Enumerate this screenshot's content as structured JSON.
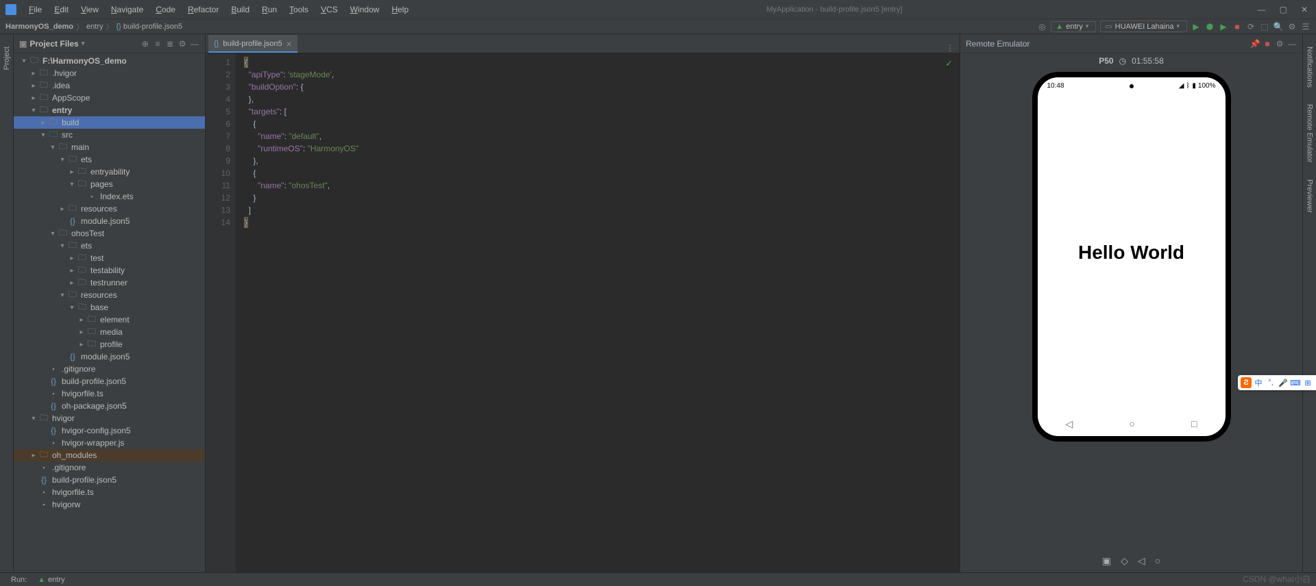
{
  "title": "MyApplication - build-profile.json5 [entry]",
  "menu": [
    "File",
    "Edit",
    "View",
    "Navigate",
    "Code",
    "Refactor",
    "Build",
    "Run",
    "Tools",
    "VCS",
    "Window",
    "Help"
  ],
  "breadcrumb": {
    "parts": [
      "HarmonyOS_demo",
      "entry",
      "build-profile.json5"
    ]
  },
  "navbar_right": {
    "entry_label": "entry",
    "device_label": "HUAWEI Lahaina"
  },
  "project_panel": {
    "title": "Project Files"
  },
  "tree": [
    {
      "depth": 0,
      "expand": "▾",
      "icon": "folder-open",
      "label": "F:\\HarmonyOS_demo",
      "bold": true
    },
    {
      "depth": 1,
      "expand": "▸",
      "icon": "folder",
      "label": ".hvigor"
    },
    {
      "depth": 1,
      "expand": "▸",
      "icon": "folder",
      "label": ".idea"
    },
    {
      "depth": 1,
      "expand": "▸",
      "icon": "folder",
      "label": "AppScope"
    },
    {
      "depth": 1,
      "expand": "▾",
      "icon": "folder-open",
      "label": "entry",
      "bold": true
    },
    {
      "depth": 2,
      "expand": "▸",
      "icon": "build",
      "label": "build",
      "selected": true
    },
    {
      "depth": 2,
      "expand": "▾",
      "icon": "folder-src",
      "label": "src"
    },
    {
      "depth": 3,
      "expand": "▾",
      "icon": "folder-open",
      "label": "main"
    },
    {
      "depth": 4,
      "expand": "▾",
      "icon": "folder-open",
      "label": "ets"
    },
    {
      "depth": 5,
      "expand": "▸",
      "icon": "folder",
      "label": "entryability"
    },
    {
      "depth": 5,
      "expand": "▾",
      "icon": "folder-open",
      "label": "pages"
    },
    {
      "depth": 6,
      "expand": " ",
      "icon": "file",
      "label": "Index.ets"
    },
    {
      "depth": 4,
      "expand": "▸",
      "icon": "folder",
      "label": "resources"
    },
    {
      "depth": 4,
      "expand": " ",
      "icon": "json",
      "label": "module.json5"
    },
    {
      "depth": 3,
      "expand": "▾",
      "icon": "folder-open",
      "label": "ohosTest"
    },
    {
      "depth": 4,
      "expand": "▾",
      "icon": "folder-open",
      "label": "ets"
    },
    {
      "depth": 5,
      "expand": "▸",
      "icon": "folder",
      "label": "test"
    },
    {
      "depth": 5,
      "expand": "▸",
      "icon": "folder",
      "label": "testability"
    },
    {
      "depth": 5,
      "expand": "▸",
      "icon": "folder",
      "label": "testrunner"
    },
    {
      "depth": 4,
      "expand": "▾",
      "icon": "folder-open",
      "label": "resources"
    },
    {
      "depth": 5,
      "expand": "▾",
      "icon": "folder-open",
      "label": "base"
    },
    {
      "depth": 6,
      "expand": "▸",
      "icon": "folder",
      "label": "element"
    },
    {
      "depth": 6,
      "expand": "▸",
      "icon": "folder",
      "label": "media"
    },
    {
      "depth": 6,
      "expand": "▸",
      "icon": "folder",
      "label": "profile"
    },
    {
      "depth": 4,
      "expand": " ",
      "icon": "json",
      "label": "module.json5"
    },
    {
      "depth": 2,
      "expand": " ",
      "icon": "file",
      "label": ".gitignore"
    },
    {
      "depth": 2,
      "expand": " ",
      "icon": "json",
      "label": "build-profile.json5"
    },
    {
      "depth": 2,
      "expand": " ",
      "icon": "file",
      "label": "hvigorfile.ts"
    },
    {
      "depth": 2,
      "expand": " ",
      "icon": "json",
      "label": "oh-package.json5"
    },
    {
      "depth": 1,
      "expand": "▾",
      "icon": "folder-open",
      "label": "hvigor"
    },
    {
      "depth": 2,
      "expand": " ",
      "icon": "json",
      "label": "hvigor-config.json5"
    },
    {
      "depth": 2,
      "expand": " ",
      "icon": "file",
      "label": "hvigor-wrapper.js"
    },
    {
      "depth": 1,
      "expand": "▸",
      "icon": "build",
      "label": "oh_modules",
      "highlight": true
    },
    {
      "depth": 1,
      "expand": " ",
      "icon": "file",
      "label": ".gitignore"
    },
    {
      "depth": 1,
      "expand": " ",
      "icon": "json",
      "label": "build-profile.json5"
    },
    {
      "depth": 1,
      "expand": " ",
      "icon": "file",
      "label": "hvigorfile.ts"
    },
    {
      "depth": 1,
      "expand": " ",
      "icon": "file",
      "label": "hvigorw"
    }
  ],
  "editor": {
    "tab_label": "build-profile.json5",
    "lines": [
      {
        "n": 1,
        "html": "<span class='brace brace-match'>{</span>"
      },
      {
        "n": 2,
        "html": "  <span class='key'>\"apiType\"</span>: <span class='string'>'stageMode'</span>,"
      },
      {
        "n": 3,
        "html": "  <span class='key'>\"buildOption\"</span>: <span class='brace'>{</span>"
      },
      {
        "n": 4,
        "html": "  <span class='brace'>}</span>,"
      },
      {
        "n": 5,
        "html": "  <span class='key'>\"targets\"</span>: <span class='brace'>[</span>"
      },
      {
        "n": 6,
        "html": "    <span class='brace'>{</span>"
      },
      {
        "n": 7,
        "html": "      <span class='key'>\"name\"</span>: <span class='string'>\"default\"</span>,"
      },
      {
        "n": 8,
        "html": "      <span class='key'>\"runtimeOS\"</span>: <span class='string'>\"HarmonyOS\"</span>"
      },
      {
        "n": 9,
        "html": "    <span class='brace'>}</span>,"
      },
      {
        "n": 10,
        "html": "    <span class='brace'>{</span>"
      },
      {
        "n": 11,
        "html": "      <span class='key'>\"name\"</span>: <span class='string'>\"ohosTest\"</span>,"
      },
      {
        "n": 12,
        "html": "    <span class='brace'>}</span>"
      },
      {
        "n": 13,
        "html": "  <span class='brace'>]</span>"
      },
      {
        "n": 14,
        "html": "<span class='brace brace-match'>}</span>"
      }
    ]
  },
  "emulator": {
    "title": "Remote Emulator",
    "device": "P50",
    "timer": "01:55:58",
    "phone": {
      "time": "10:48",
      "battery": "100%",
      "content": "Hello World"
    }
  },
  "left_tabs": [
    "Project"
  ],
  "right_tabs": [
    "Notifications",
    "Remote Emulator",
    "Previewer"
  ],
  "bottom": {
    "run_label": "Run:",
    "run_target": "entry"
  },
  "watermark": "CSDN @what小白",
  "float_toolbar": {
    "ime": "中"
  }
}
